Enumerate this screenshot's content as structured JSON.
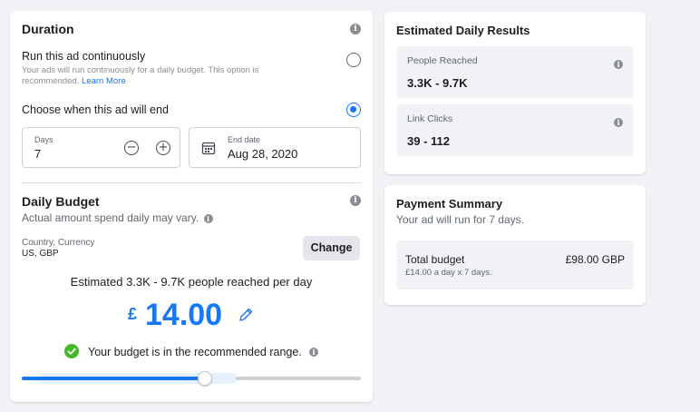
{
  "duration": {
    "title": "Duration",
    "continuous": {
      "title": "Run this ad continuously",
      "description": "Your ads will run continuously for a daily budget. This option is recommended.",
      "learn_more": "Learn More",
      "selected": false
    },
    "end_choice": {
      "title": "Choose when this ad will end",
      "selected": true
    },
    "days": {
      "label": "Days",
      "value": "7",
      "minus": "−",
      "plus": "+"
    },
    "end_date": {
      "label": "End date",
      "value": "Aug 28, 2020"
    }
  },
  "budget": {
    "title": "Daily Budget",
    "subtitle": "Actual amount spend daily may vary.",
    "country_label": "Country, Currency",
    "country_value": "US, GBP",
    "change_label": "Change",
    "estimate": "Estimated 3.3K - 9.7K people reached per day",
    "currency_symbol": "£",
    "amount": "14.00",
    "recommendation": "Your budget is in the recommended range.",
    "slider_fraction": 0.54
  },
  "results": {
    "title": "Estimated Daily Results",
    "people_reached": {
      "label": "People Reached",
      "value": "3.3K - 9.7K"
    },
    "link_clicks": {
      "label": "Link Clicks",
      "value": "39 - 112"
    }
  },
  "payment": {
    "title": "Payment Summary",
    "subtitle": "Your ad will run for 7 days.",
    "total_label": "Total budget",
    "total_value": "£98.00 GBP",
    "breakdown": "£14.00 a day x 7 days."
  },
  "colors": {
    "accent": "#1877f2",
    "success": "#42b72a",
    "background": "#f0f2f5"
  },
  "icons": [
    "info-icon",
    "minus-circle-icon",
    "plus-circle-icon",
    "calendar-icon",
    "pencil-icon",
    "check-circle-icon"
  ]
}
